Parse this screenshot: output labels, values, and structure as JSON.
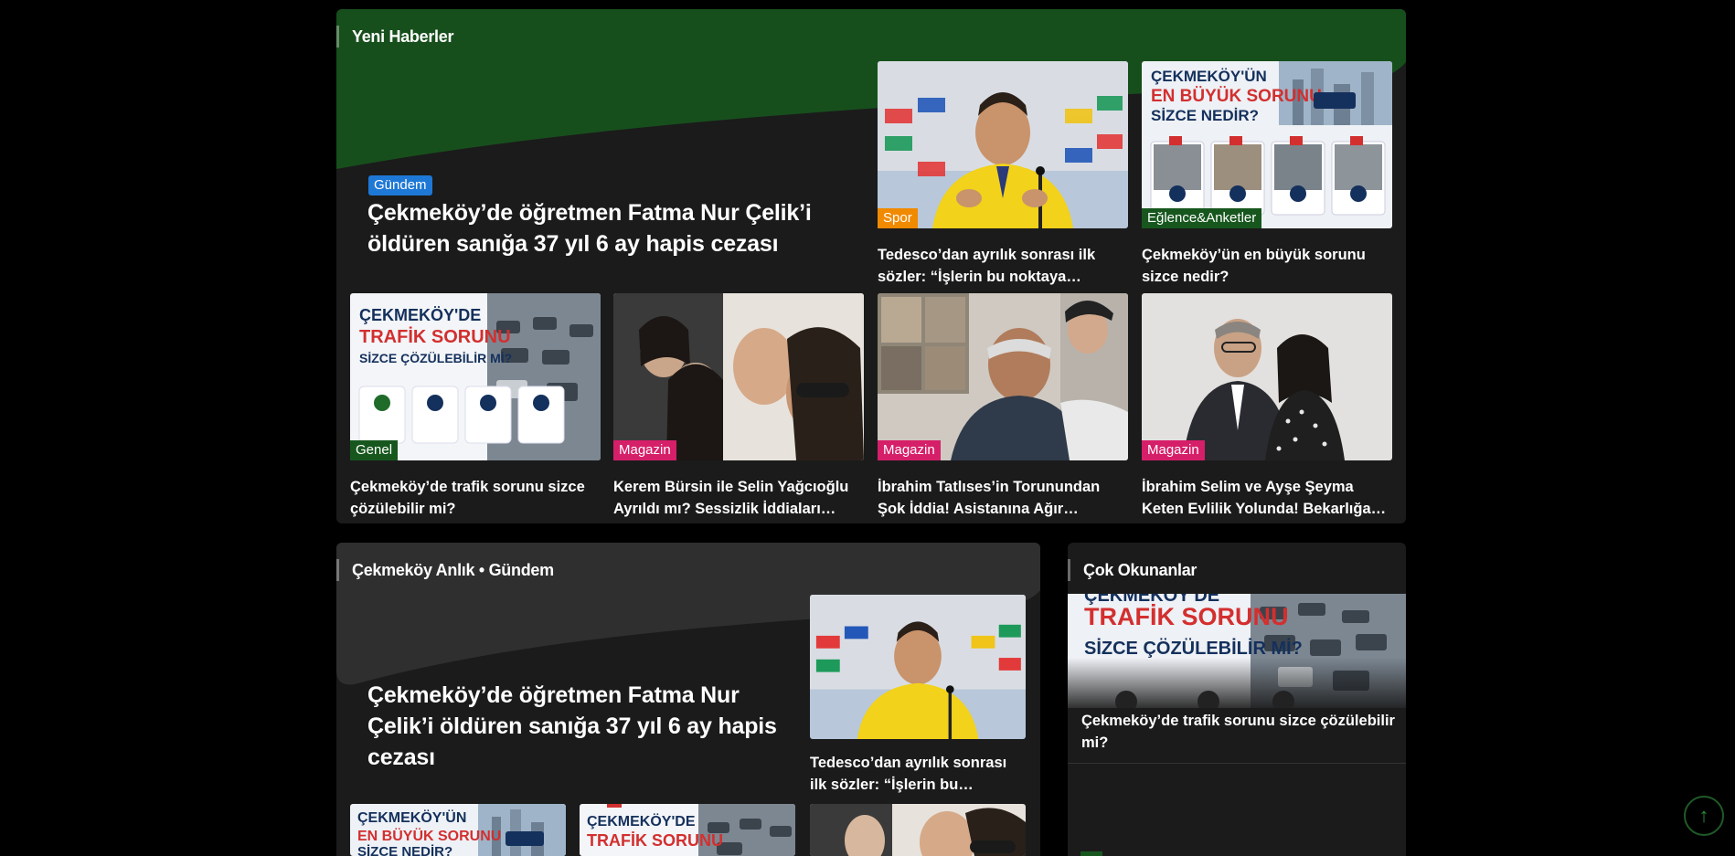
{
  "section1": {
    "title": "Yeni Haberler",
    "lead": {
      "badge": "Gündem",
      "title": "Çekmeköy’de öğretmen Fatma Nur Çelik’i öldüren sanığa 37 yıl 6 ay hapis cezası"
    },
    "top_cards": [
      {
        "badge": "Spor",
        "badge_type": "spor",
        "title": "Tedesco’dan ayrılık sonrası ilk sözler: “İşlerin bu noktaya gelmesi…",
        "image": "coach-press-conference"
      },
      {
        "badge": "Eğlence&Anketler",
        "badge_type": "eglence",
        "title": "Çekmeköy’ün en büyük sorunu sizce nedir?",
        "image": "poll-biggest-problem",
        "poster_text": [
          "ÇEKMEKÖY'ÜN",
          "EN BÜYÜK SORUNU",
          "SİZCE NEDİR?"
        ]
      }
    ],
    "bottom_cards": [
      {
        "badge": "Genel",
        "badge_type": "genel",
        "title": "Çekmeköy’de trafik sorunu sizce çözülebilir mi?",
        "image": "poll-traffic",
        "poster_text": [
          "ÇEKMEKÖY'DE",
          "TRAFİK SORUNU",
          "SİZCE ÇÖZÜLEBİLİR Mİ?"
        ]
      },
      {
        "badge": "Magazin",
        "badge_type": "magazin",
        "title": "Kerem Bürsin ile Selin Yağcıoğlu Ayrıldı mı? Sessizlik İddiaları…",
        "image": "celebrity-couple"
      },
      {
        "badge": "Magazin",
        "badge_type": "magazin",
        "title": "İbrahim Tatlıses’in Torunundan Şok İddia! Asistanına Ağır Suçlama:…",
        "image": "singer-collage"
      },
      {
        "badge": "Magazin",
        "badge_type": "magazin",
        "title": "İbrahim Selim ve Ayşe Şeyma Keten Evlilik Yolunda! Bekarlığa…",
        "image": "couple-portrait"
      }
    ]
  },
  "section2": {
    "title": "Çekmeköy Anlık • Gündem",
    "lead": {
      "title": "Çekmeköy’de öğretmen Fatma Nur Çelik’i öldüren sanığa 37 yıl 6 ay hapis cezası"
    },
    "side_card": {
      "title": "Tedesco’dan ayrılık sonrası ilk sözler: “İşlerin bu noktaya…",
      "image": "coach-press-conference"
    },
    "bottom_cards": [
      {
        "image": "poll-biggest-problem",
        "poster_text": [
          "ÇEKMEKÖY'ÜN",
          "EN BÜYÜK SORUNU",
          "SİZCE NEDİR?"
        ]
      },
      {
        "image": "poll-traffic",
        "poster_text": [
          "ÇEKMEKÖY'DE",
          "TRAFİK SORUNU",
          ""
        ]
      },
      {
        "image": "celebrity-couple"
      }
    ]
  },
  "most_read": {
    "title": "Çok Okunanlar",
    "items": [
      {
        "title": "Çekmeköy’de trafik sorunu sizce çözülebilir mi?",
        "image": "poll-traffic",
        "poster_text": [
          "ÇEKMEKÖY'DE",
          "TRAFİK SORUNU",
          "SİZCE ÇÖZÜLEBİLİR Mİ?"
        ]
      }
    ]
  },
  "scroll_top": {
    "icon": "arrow-up-icon",
    "glyph": "↑"
  },
  "colors": {
    "accent_green": "#17571e",
    "wave_green": "#174f1c",
    "wave_grey": "#2f2f2f",
    "panel": "#1b1b1b",
    "background": "#000000"
  }
}
